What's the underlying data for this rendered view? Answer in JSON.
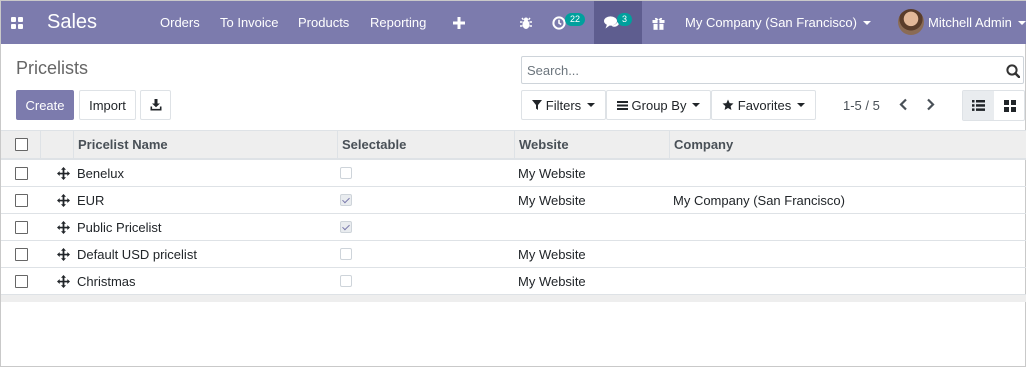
{
  "navbar": {
    "app_name": "Sales",
    "menu": [
      "Orders",
      "To Invoice",
      "Products",
      "Reporting"
    ],
    "activity_count": "22",
    "messages_count": "3",
    "company": "My Company (San Francisco)",
    "user": "Mitchell Admin",
    "icons": [
      "apps-icon",
      "plus-icon",
      "bug-icon",
      "clock-icon",
      "chat-icon",
      "gift-icon"
    ]
  },
  "page": {
    "title": "Pricelists"
  },
  "search": {
    "placeholder": "Search..."
  },
  "buttons": {
    "create": "Create",
    "import": "Import"
  },
  "filters": {
    "filters": "Filters",
    "group_by": "Group By",
    "favorites": "Favorites"
  },
  "pager": {
    "value": "1-5 / 5"
  },
  "table": {
    "columns": [
      "Pricelist Name",
      "Selectable",
      "Website",
      "Company"
    ],
    "rows": [
      {
        "name": "Benelux",
        "selectable": false,
        "website": "My Website",
        "company": ""
      },
      {
        "name": "EUR",
        "selectable": true,
        "website": "My Website",
        "company": "My Company (San Francisco)"
      },
      {
        "name": "Public Pricelist",
        "selectable": true,
        "website": "",
        "company": ""
      },
      {
        "name": "Default USD pricelist",
        "selectable": false,
        "website": "My Website",
        "company": ""
      },
      {
        "name": "Christmas",
        "selectable": false,
        "website": "My Website",
        "company": ""
      }
    ]
  },
  "colors": {
    "brand": "#7c7bad",
    "brand_dark": "#5e5d8f",
    "badge": "#00a09d"
  }
}
